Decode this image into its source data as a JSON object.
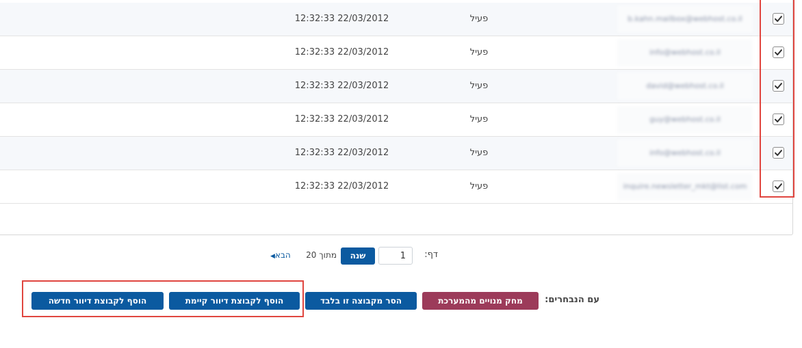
{
  "table": {
    "rows": [
      {
        "email": "b.kahn.mailbox@webhost.co.il",
        "status": "פעיל",
        "date": "12:32:33 22/03/2012",
        "checked": true
      },
      {
        "email": "info@webhost.co.il",
        "status": "פעיל",
        "date": "12:32:33 22/03/2012",
        "checked": true
      },
      {
        "email": "david@webhost.co.il",
        "status": "פעיל",
        "date": "12:32:33 22/03/2012",
        "checked": true
      },
      {
        "email": "guy@webhost.co.il",
        "status": "פעיל",
        "date": "12:32:33 22/03/2012",
        "checked": true
      },
      {
        "email": "info@webhost.co.il",
        "status": "פעיל",
        "date": "12:32:33 22/03/2012",
        "checked": true
      },
      {
        "email": "inquire.newsletter_mkt@list.com",
        "status": "פעיל",
        "date": "12:32:33 22/03/2012",
        "checked": true
      }
    ]
  },
  "pager": {
    "label": "דף:",
    "page_value": "1",
    "go_button": "שנה",
    "total_text": "מתוך 20",
    "next_label": "הבא",
    "next_icon": "triangle-left-icon"
  },
  "actions": {
    "label": "עם הנבחרים:",
    "delete_button": "מחק מנויים מהמערכת",
    "remove_button": "הסר מקבוצה זו בלבד",
    "add_existing_button": "הוסף לקבוצת דיוור קיימת",
    "add_new_button": "הוסף לקבוצת דיוור חדשה"
  },
  "colors": {
    "primary_button": "#0b5aa0",
    "danger_button": "#9c3b5a",
    "highlight_box": "#e0453f"
  }
}
